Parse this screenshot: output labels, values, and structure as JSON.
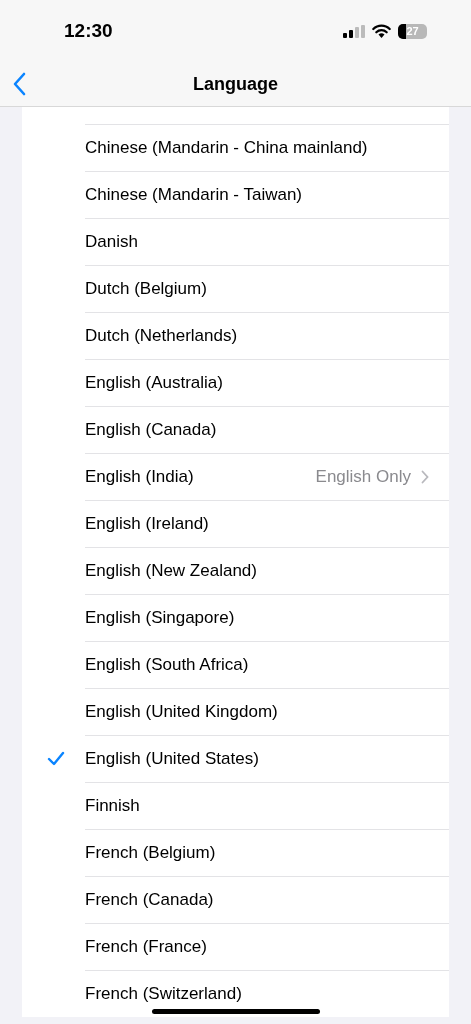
{
  "status_bar": {
    "time": "12:30",
    "battery": "27"
  },
  "nav": {
    "title": "Language"
  },
  "languages": [
    {
      "name": "Chinese (Mandarin - China mainland)",
      "selected": false
    },
    {
      "name": "Chinese (Mandarin - Taiwan)",
      "selected": false
    },
    {
      "name": "Danish",
      "selected": false
    },
    {
      "name": "Dutch (Belgium)",
      "selected": false
    },
    {
      "name": "Dutch (Netherlands)",
      "selected": false
    },
    {
      "name": "English (Australia)",
      "selected": false
    },
    {
      "name": "English (Canada)",
      "selected": false
    },
    {
      "name": "English (India)",
      "selected": false,
      "detail": "English Only"
    },
    {
      "name": "English (Ireland)",
      "selected": false
    },
    {
      "name": "English (New Zealand)",
      "selected": false
    },
    {
      "name": "English (Singapore)",
      "selected": false
    },
    {
      "name": "English (South Africa)",
      "selected": false
    },
    {
      "name": "English (United Kingdom)",
      "selected": false
    },
    {
      "name": "English (United States)",
      "selected": true
    },
    {
      "name": "Finnish",
      "selected": false
    },
    {
      "name": "French (Belgium)",
      "selected": false
    },
    {
      "name": "French (Canada)",
      "selected": false
    },
    {
      "name": "French (France)",
      "selected": false
    },
    {
      "name": "French (Switzerland)",
      "selected": false
    }
  ]
}
